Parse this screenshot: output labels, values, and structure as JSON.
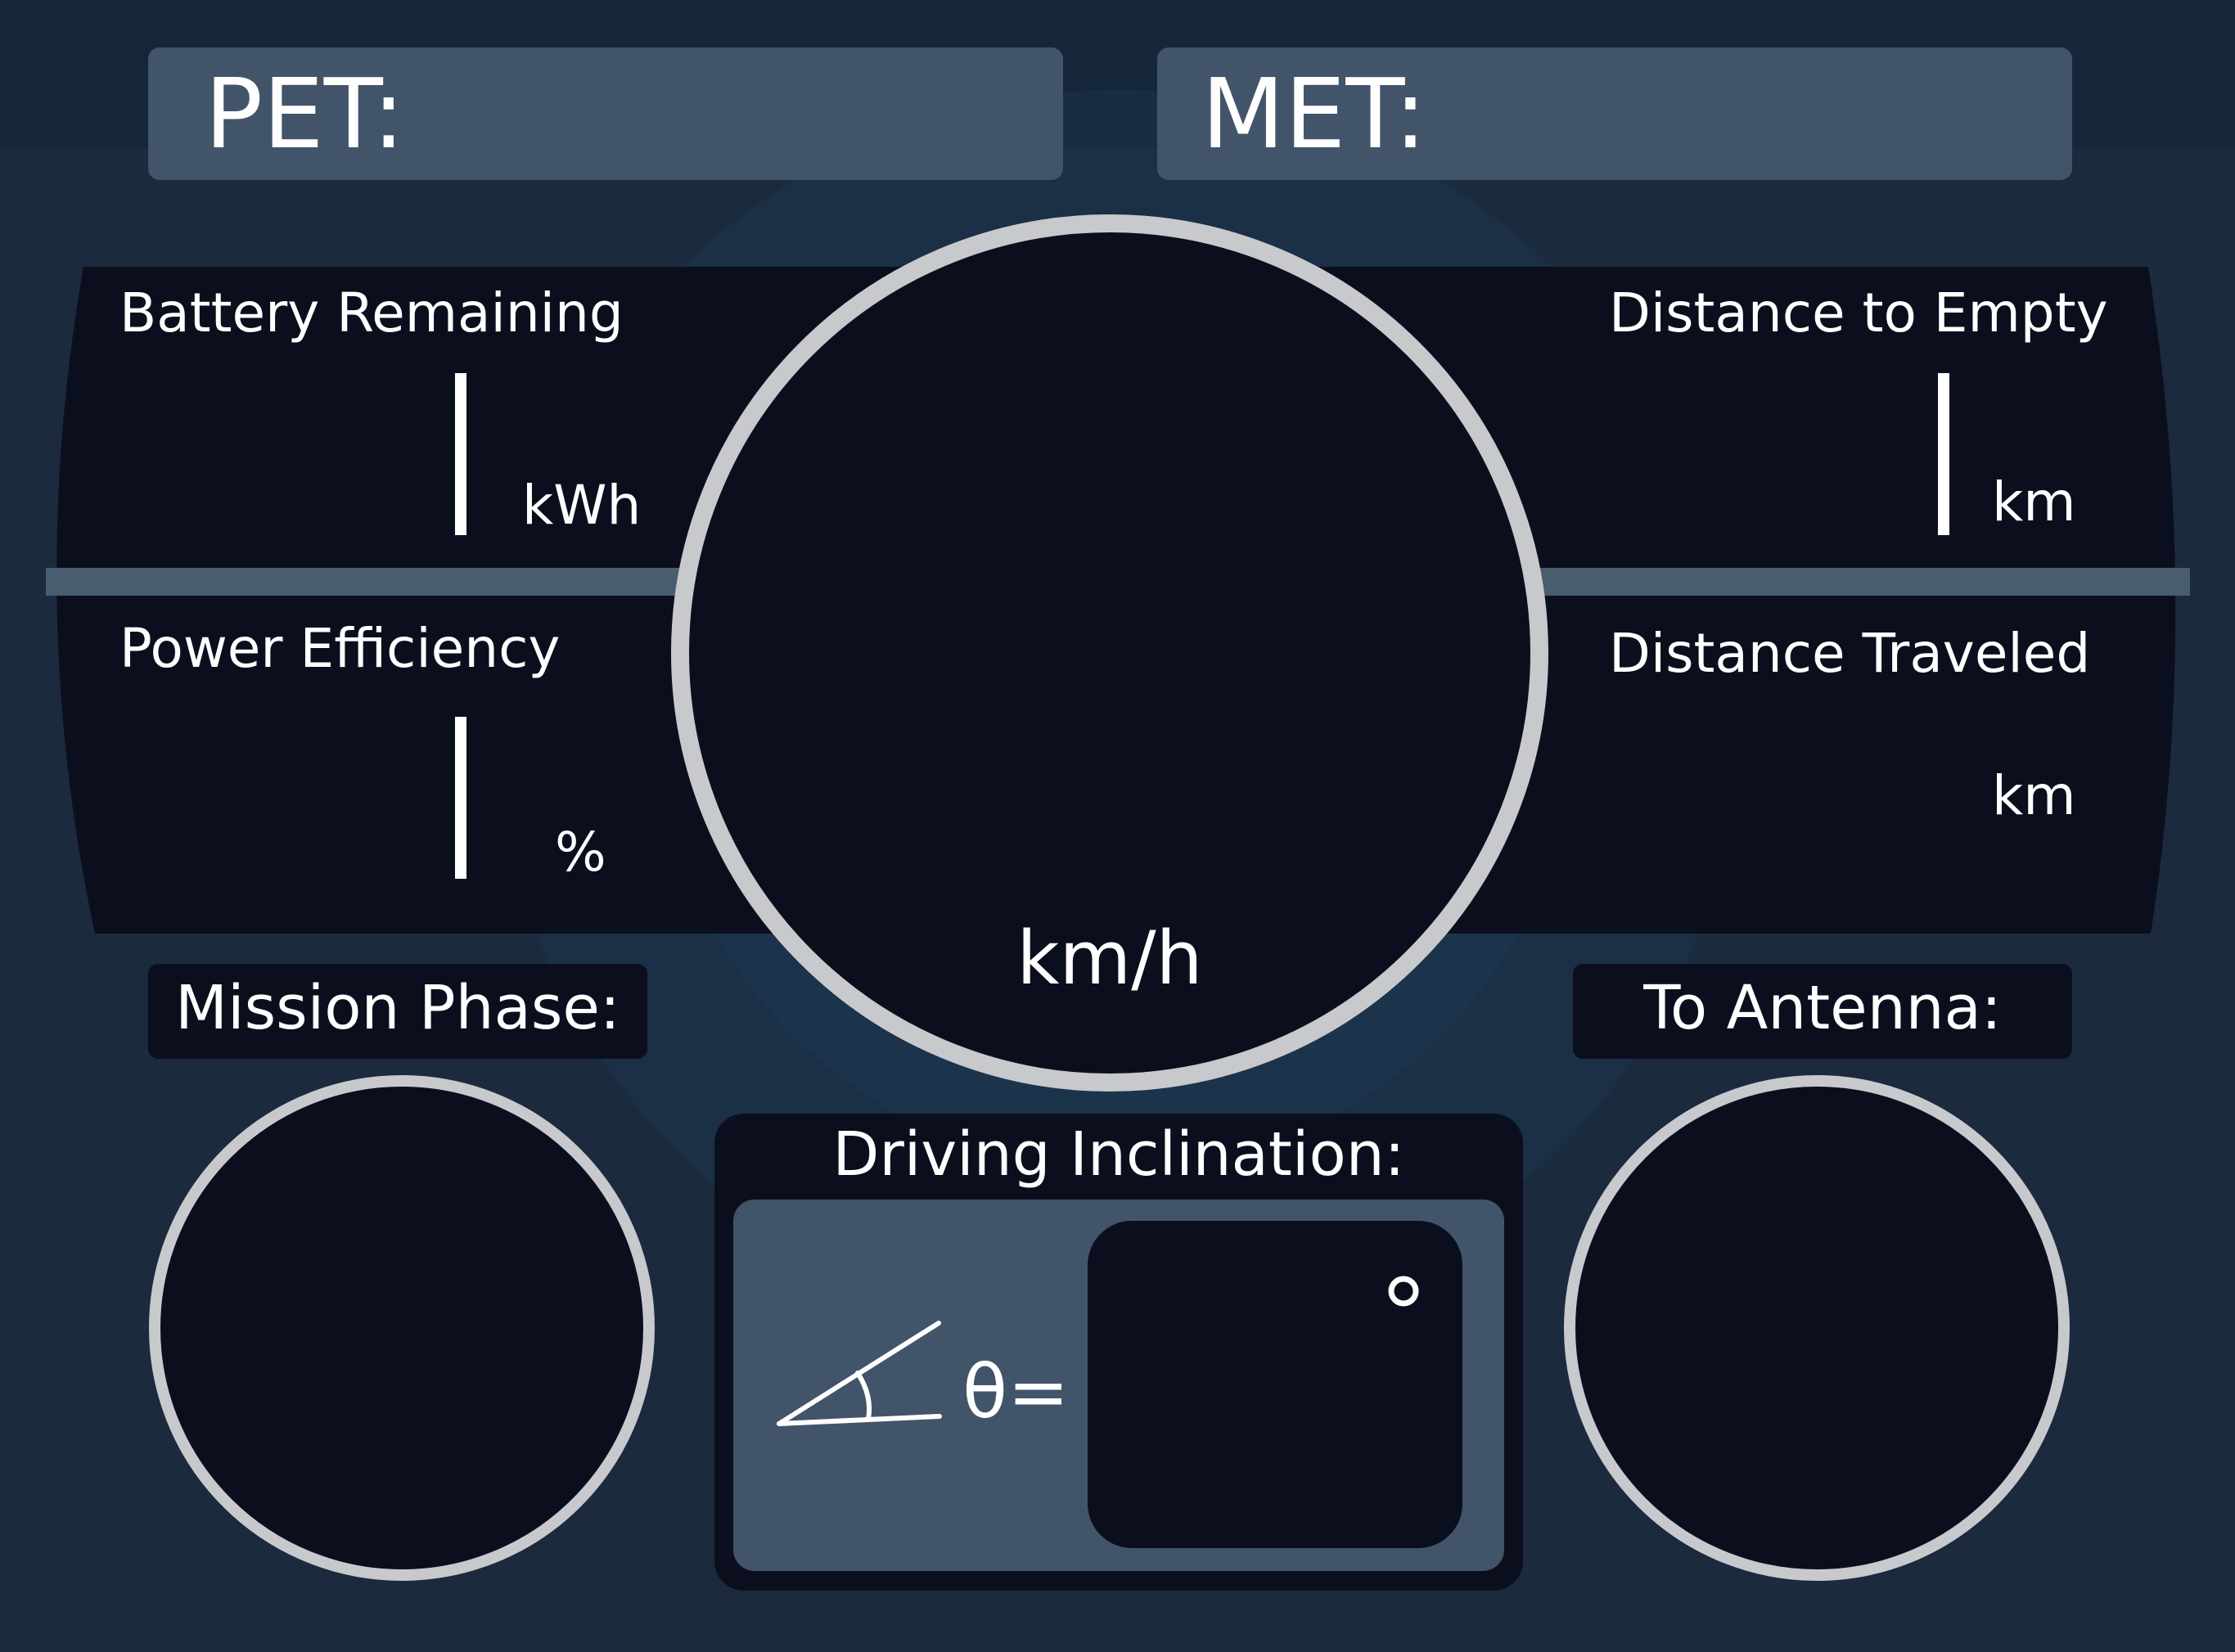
{
  "colors": {
    "background": "#1b2a3d",
    "top_strip": "#16263a",
    "panel_dark": "#0b0f1d",
    "panel_slate": "#425469",
    "divider": "#4a5c70",
    "ring": "#c8c9cc",
    "text": "#ffffff",
    "globe_accent": "#1c3a5a"
  },
  "header": {
    "pet_label": "PET:",
    "pet_value": "",
    "met_label": "MET:",
    "met_value": ""
  },
  "left_panel": {
    "battery": {
      "label": "Battery Remaining",
      "value": "",
      "unit": "kWh"
    },
    "efficiency": {
      "label": "Power Efficiency",
      "value": "",
      "unit": "%"
    }
  },
  "right_panel": {
    "distance_empty": {
      "label": "Distance to Empty",
      "value": "",
      "unit": "km"
    },
    "distance_traveled": {
      "label": "Distance Traveled",
      "value": "",
      "unit": "km"
    }
  },
  "speedometer": {
    "value": "",
    "unit": "km/h"
  },
  "mission_phase": {
    "label": "Mission Phase:",
    "value": ""
  },
  "antenna": {
    "label": "To Antenna:",
    "value": ""
  },
  "inclination": {
    "label": "Driving Inclination:",
    "symbol": "θ=",
    "value": "",
    "unit": "°",
    "icon": "angle-icon"
  }
}
